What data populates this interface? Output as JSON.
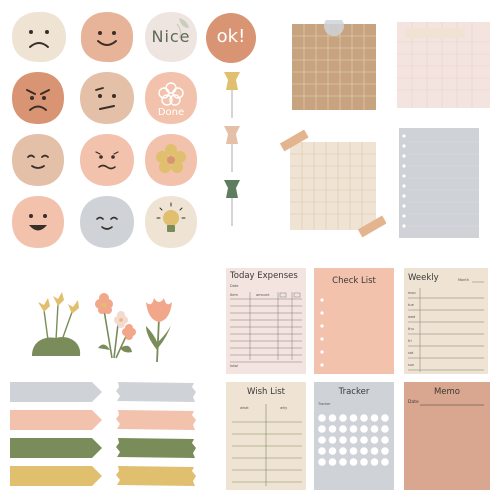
{
  "stickers": {
    "nice": "Nice",
    "ok": "ok!",
    "done": "Done"
  },
  "planners": {
    "today_expenses": {
      "title": "Today Expenses",
      "date_label": "Date",
      "col_item": "Item",
      "col_amount": "amount",
      "total_label": "total"
    },
    "check_list": {
      "title": "Check List"
    },
    "weekly": {
      "title": "Weekly",
      "month_label": "Month",
      "days": [
        "mon",
        "tue",
        "wed",
        "thu",
        "fri",
        "sat",
        "sun"
      ]
    },
    "wish_list": {
      "title": "Wish List",
      "col_what": "what",
      "col_why": "why"
    },
    "tracker": {
      "title": "Tracker",
      "sub_label": "Tracker"
    },
    "memo": {
      "title": "Memo",
      "date_label": "Date"
    }
  },
  "palette": {
    "cream": "#efe3d3",
    "peach": "#e7b499",
    "terracotta": "#d89473",
    "sand": "#e3b48d",
    "tan": "#c7a47f",
    "rose": "#f2c2ad",
    "grey": "#cfd3d8",
    "sage": "#7a8c59",
    "mustard": "#e0bf6e",
    "light_pink": "#f4e4e0"
  }
}
